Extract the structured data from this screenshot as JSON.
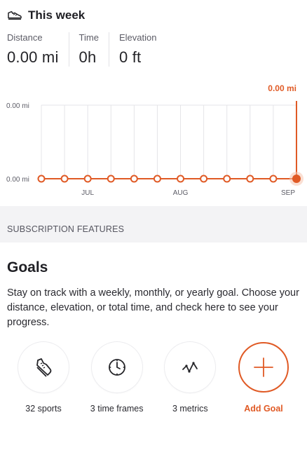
{
  "header": {
    "title": "This week",
    "icon": "running-shoe-icon"
  },
  "stats": [
    {
      "label": "Distance",
      "value": "0.00 mi"
    },
    {
      "label": "Time",
      "value": "0h"
    },
    {
      "label": "Elevation",
      "value": "0 ft"
    }
  ],
  "chart_data": {
    "type": "line",
    "current_label": "0.00 mi",
    "y_tick_labels": [
      "0.00 mi",
      "0.00 mi"
    ],
    "x_tick_labels": [
      "JUL",
      "AUG",
      "SEP"
    ],
    "x": [
      "wk1",
      "wk2",
      "wk3",
      "wk4",
      "wk5",
      "wk6",
      "wk7",
      "wk8",
      "wk9",
      "wk10",
      "wk11",
      "wk12"
    ],
    "values": [
      0,
      0,
      0,
      0,
      0,
      0,
      0,
      0,
      0,
      0,
      0,
      0
    ],
    "ylim": [
      0,
      0
    ],
    "grid": true,
    "highlight_index": 11
  },
  "colors": {
    "accent": "#e05a25",
    "grid": "#e4e4e8",
    "muted": "#5c5c66"
  },
  "subscription": {
    "label": "SUBSCRIPTION FEATURES"
  },
  "goals": {
    "title": "Goals",
    "description": "Stay on track with a weekly, monthly, or yearly goal. Choose your distance, elevation, or total time, and check here to see your progress."
  },
  "features": [
    {
      "label": "32 sports",
      "icon": "shoe-icon"
    },
    {
      "label": "3 time frames",
      "icon": "clock-icon"
    },
    {
      "label": "3 metrics",
      "icon": "metrics-icon"
    },
    {
      "label": "Add Goal",
      "icon": "plus-icon"
    }
  ]
}
